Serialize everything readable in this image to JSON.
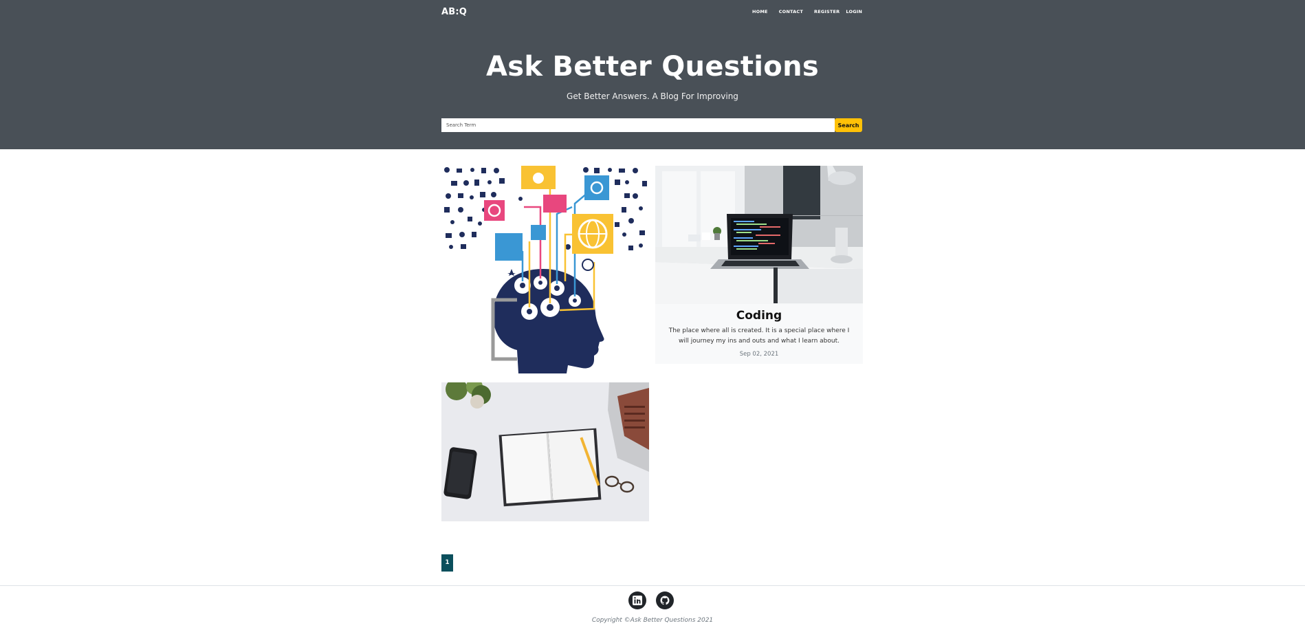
{
  "brand": "AB:Q",
  "nav": {
    "home": "HOME",
    "contact": "CONTACT",
    "register": "REGISTER",
    "login": "LOGIN"
  },
  "hero": {
    "title": "Ask Better Questions",
    "subtitle": "Get Better Answers. A Blog For Improving"
  },
  "search": {
    "placeholder": "Search Term",
    "button_label": "Search"
  },
  "posts": [
    {
      "image": "head-gears-illustration"
    },
    {
      "image": "laptop-code-desk-photo",
      "title": "Coding",
      "excerpt": "The place where all is created. It is a special place where I will journey my ins and outs and what I learn about.",
      "date": "Sep 02, 2021"
    },
    {
      "image": "notebook-phone-desk-photo"
    }
  ],
  "pagination": {
    "current": "1"
  },
  "footer": {
    "social": [
      "linkedin-icon",
      "github-icon"
    ],
    "copyright": "Copyright ©Ask Better Questions 2021"
  },
  "colors": {
    "hero_bg": "#495057",
    "accent": "#ffc107",
    "page_active": "#0b4f5c"
  }
}
